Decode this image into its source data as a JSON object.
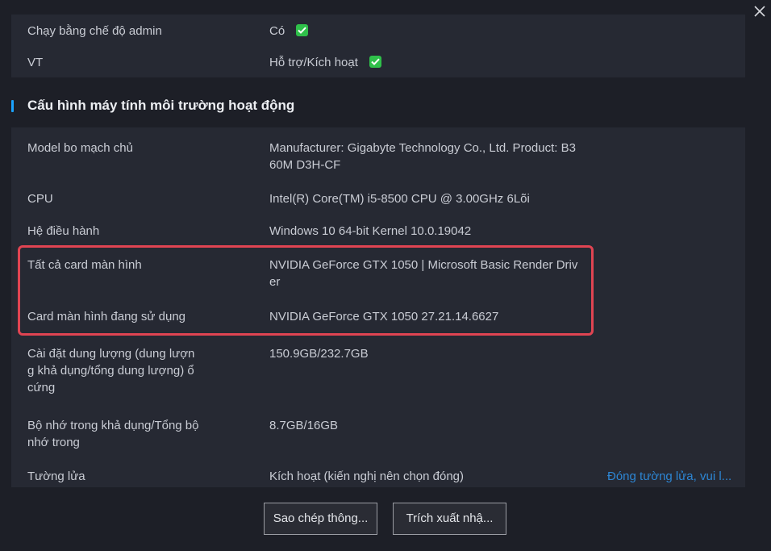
{
  "window": {
    "close_icon": "close-icon"
  },
  "top_rows": [
    {
      "label": "Chạy bằng chế độ admin",
      "value": "Có",
      "status_icon": "check-icon"
    },
    {
      "label": "VT",
      "value": "Hỗ trợ/Kích hoạt",
      "status_icon": "check-icon"
    }
  ],
  "section": {
    "title": "Cấu hình máy tính môi trường hoạt động"
  },
  "rows": [
    {
      "label": "Model bo mạch chủ",
      "value": "Manufacturer: Gigabyte Technology Co., Ltd.  Product: B360M D3H-CF"
    },
    {
      "label": "CPU",
      "value": "Intel(R) Core(TM) i5-8500 CPU @ 3.00GHz 6Lõi"
    },
    {
      "label": "Hệ điều hành",
      "value": "Windows 10 64-bit Kernel 10.0.19042"
    },
    {
      "label": "Tất cả card màn hình",
      "value": "NVIDIA GeForce GTX 1050 | Microsoft Basic Render Driver"
    },
    {
      "label": "Card màn hình đang sử dụng",
      "value": "NVIDIA GeForce GTX 1050 27.21.14.6627"
    },
    {
      "label": "Cài đặt dung lượng (dung lượng khả dụng/tổng dung lượng) ổ cứng",
      "value": "150.9GB/232.7GB"
    },
    {
      "label": "Bộ nhớ trong khả dụng/Tổng bộ nhớ trong",
      "value": "8.7GB/16GB"
    },
    {
      "label": "Tường lửa",
      "value": "Kích hoạt (kiến nghị nên chọn đóng)",
      "link": "Đóng tường lửa, vui l..."
    }
  ],
  "buttons": {
    "copy_label": "Sao chép thông...",
    "export_label": "Trích xuất nhậ..."
  },
  "colors": {
    "background": "#1d1f27",
    "card": "#262933",
    "accent": "#1aa3ff",
    "check": "#2fc04a",
    "highlight": "#e04452",
    "link": "#2d86d4"
  }
}
